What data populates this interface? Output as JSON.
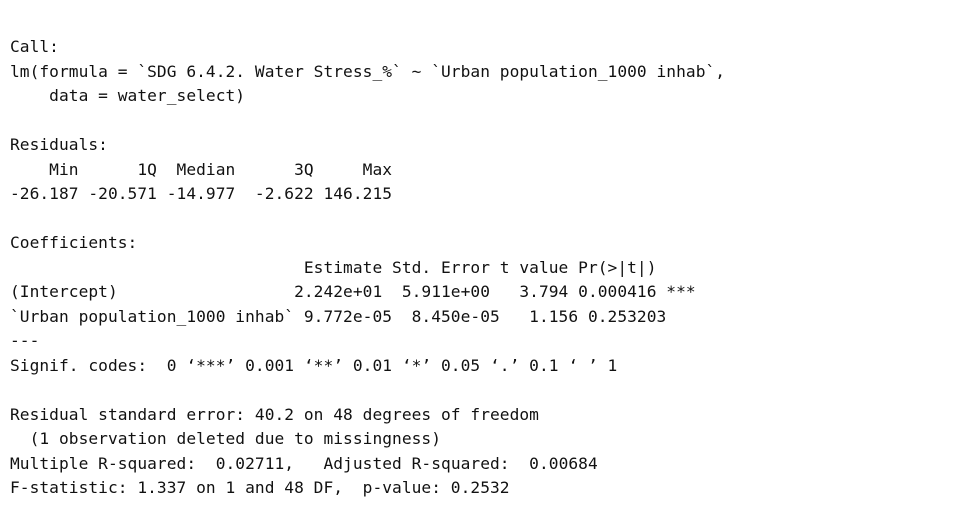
{
  "console": {
    "lines": [
      "Call:",
      "lm(formula = `SDG 6.4.2. Water Stress_%` ~ `Urban population_1000 inhab`,",
      "    data = water_select)",
      "",
      "Residuals:",
      "    Min      1Q  Median      3Q     Max ",
      "-26.187 -20.571 -14.977  -2.622 146.215 ",
      "",
      "Coefficients:",
      "                              Estimate Std. Error t value Pr(>|t|)    ",
      "(Intercept)                  2.242e+01  5.911e+00   3.794 0.000416 ***",
      "`Urban population_1000 inhab` 9.772e-05  8.450e-05   1.156 0.253203    ",
      "---",
      "Signif. codes:  0 ‘***’ 0.001 ‘**’ 0.01 ‘*’ 0.05 ‘.’ 0.1 ‘ ’ 1",
      "",
      "Residual standard error: 40.2 on 48 degrees of freedom",
      "  (1 observation deleted due to missingness)",
      "Multiple R-squared:  0.02711,\tAdjusted R-squared:  0.00684 ",
      "F-statistic: 1.337 on 1 and 48 DF,  p-value: 0.2532"
    ]
  }
}
